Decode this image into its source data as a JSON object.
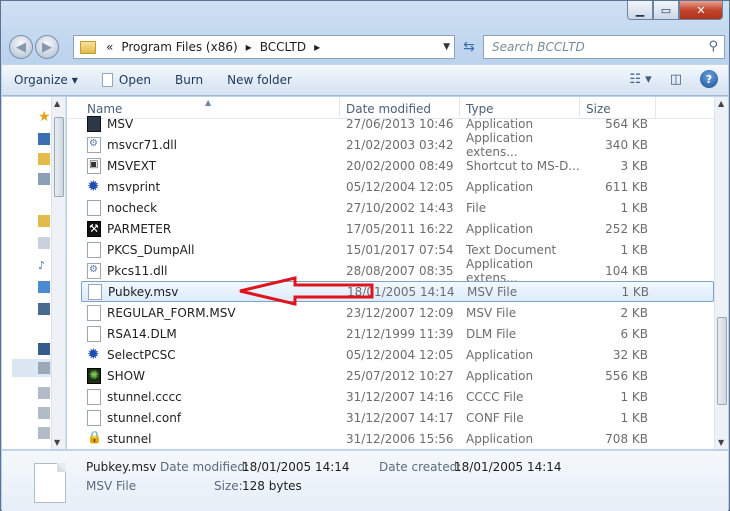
{
  "window": {
    "buttons": {
      "minimize": "▁",
      "maximize": "▭",
      "close": "✕"
    }
  },
  "nav": {
    "back_glyph": "◀",
    "forward_glyph": "▶",
    "breadcrumb": [
      "«",
      "Program Files (x86)",
      "▸",
      "BCCLTD",
      "▸"
    ],
    "search_placeholder": "Search BCCLTD"
  },
  "toolbar": {
    "organize": "Organize",
    "open": "Open",
    "burn": "Burn",
    "new_folder": "New folder"
  },
  "columns": {
    "name": "Name",
    "date": "Date modified",
    "type": "Type",
    "size": "Size"
  },
  "files": [
    {
      "name": "MSV",
      "date": "27/06/2013 10:46",
      "type": "Application",
      "size": "564 KB",
      "icon": "app"
    },
    {
      "name": "msvcr71.dll",
      "date": "21/02/2003 03:42",
      "type": "Application extens...",
      "size": "340 KB",
      "icon": "dll"
    },
    {
      "name": "MSVEXT",
      "date": "20/02/2000 08:49",
      "type": "Shortcut to MS-D...",
      "size": "3 KB",
      "icon": "shortcut"
    },
    {
      "name": "msvprint",
      "date": "05/12/2004 12:05",
      "type": "Application",
      "size": "611 KB",
      "icon": "gear"
    },
    {
      "name": "nocheck",
      "date": "27/10/2002 14:43",
      "type": "File",
      "size": "1 KB",
      "icon": "file"
    },
    {
      "name": "PARMETER",
      "date": "17/05/2011 16:22",
      "type": "Application",
      "size": "252 KB",
      "icon": "param"
    },
    {
      "name": "PKCS_DumpAll",
      "date": "15/01/2017 07:54",
      "type": "Text Document",
      "size": "1 KB",
      "icon": "file"
    },
    {
      "name": "Pkcs11.dll",
      "date": "28/08/2007 08:35",
      "type": "Application extens...",
      "size": "104 KB",
      "icon": "dll"
    },
    {
      "name": "Pubkey.msv",
      "date": "18/01/2005 14:14",
      "type": "MSV File",
      "size": "1 KB",
      "icon": "file",
      "selected": true
    },
    {
      "name": "REGULAR_FORM.MSV",
      "date": "23/12/2007 12:09",
      "type": "MSV File",
      "size": "2 KB",
      "icon": "file"
    },
    {
      "name": "RSA14.DLM",
      "date": "21/12/1999 11:39",
      "type": "DLM File",
      "size": "6 KB",
      "icon": "file"
    },
    {
      "name": "SelectPCSC",
      "date": "05/12/2004 12:05",
      "type": "Application",
      "size": "32 KB",
      "icon": "gear"
    },
    {
      "name": "SHOW",
      "date": "25/07/2012 10:27",
      "type": "Application",
      "size": "556 KB",
      "icon": "show"
    },
    {
      "name": "stunnel.cccc",
      "date": "31/12/2007 14:16",
      "type": "CCCC File",
      "size": "1 KB",
      "icon": "file"
    },
    {
      "name": "stunnel.conf",
      "date": "31/12/2007 14:17",
      "type": "CONF File",
      "size": "1 KB",
      "icon": "file"
    },
    {
      "name": "stunnel",
      "date": "31/12/2006 15:56",
      "type": "Application",
      "size": "708 KB",
      "icon": "stun"
    }
  ],
  "details": {
    "name": "Pubkey.msv",
    "type": "MSV File",
    "date_modified_label": "Date modified:",
    "date_modified": "18/01/2005 14:14",
    "date_created_label": "Date created:",
    "date_created": "18/01/2005 14:14",
    "size_label": "Size:",
    "size": "128 bytes"
  },
  "colors": {
    "arrow": "#e0141e",
    "selection_border": "#7da2ce"
  }
}
